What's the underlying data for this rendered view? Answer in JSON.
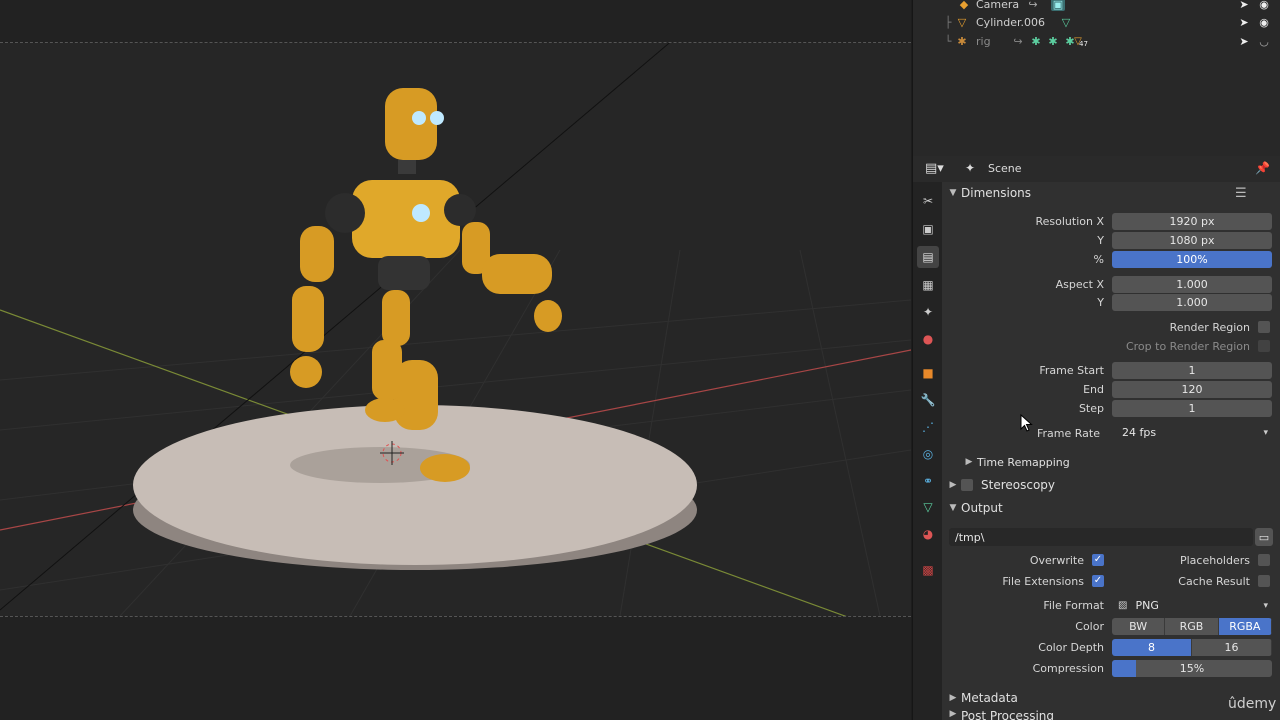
{
  "outliner": {
    "items": [
      {
        "name": "Camera"
      },
      {
        "name": "Cylinder.006"
      },
      {
        "name": "rig",
        "badge": "47"
      }
    ]
  },
  "properties": {
    "context": "Scene",
    "dimensions": {
      "title": "Dimensions",
      "resolution_x_label": "Resolution X",
      "resolution_x": "1920 px",
      "resolution_y_label": "Y",
      "resolution_y": "1080 px",
      "percent_label": "%",
      "percent": "100%",
      "aspect_x_label": "Aspect X",
      "aspect_x": "1.000",
      "aspect_y_label": "Y",
      "aspect_y": "1.000",
      "render_region_label": "Render Region",
      "crop_label": "Crop to Render Region",
      "frame_start_label": "Frame Start",
      "frame_start": "1",
      "frame_end_label": "End",
      "frame_end": "120",
      "frame_step_label": "Step",
      "frame_step": "1",
      "frame_rate_label": "Frame Rate",
      "frame_rate": "24 fps",
      "time_remapping": "Time Remapping"
    },
    "stereoscopy": "Stereoscopy",
    "output": {
      "title": "Output",
      "path": "/tmp\\",
      "overwrite": "Overwrite",
      "placeholders": "Placeholders",
      "file_extensions": "File Extensions",
      "cache_result": "Cache Result",
      "file_format_label": "File Format",
      "file_format": "PNG",
      "color_label": "Color",
      "color_options": [
        "BW",
        "RGB",
        "RGBA"
      ],
      "color_selected": "RGBA",
      "color_depth_label": "Color Depth",
      "color_depth_options": [
        "8",
        "16"
      ],
      "color_depth_selected": "8",
      "compression_label": "Compression",
      "compression": "15%",
      "compression_value": 0.15
    },
    "metadata": "Metadata",
    "post_processing": "Post Processing"
  },
  "colors": {
    "accent": "#4a74c9",
    "robot": "#e0a82a",
    "x_axis": "#b04a4a",
    "y_axis": "#8a9a3a"
  },
  "watermark": "ûdemy"
}
